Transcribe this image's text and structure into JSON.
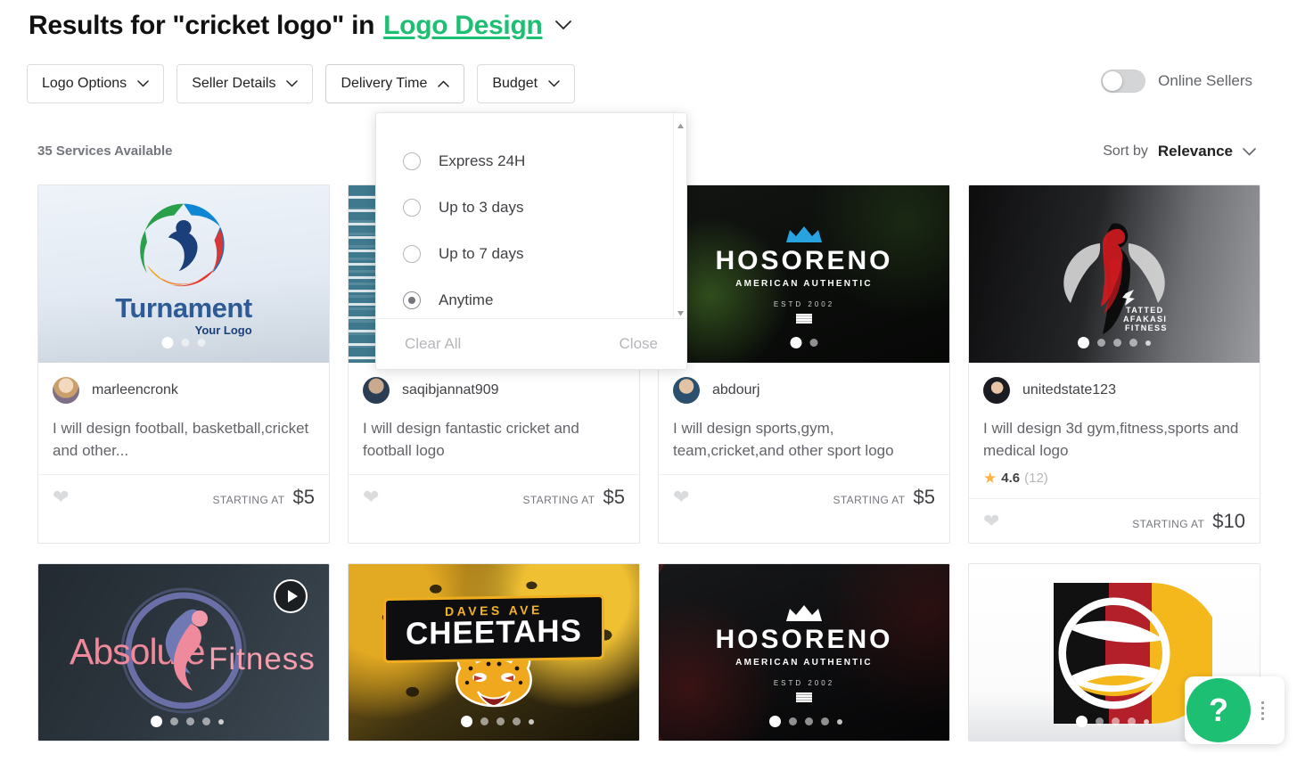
{
  "header": {
    "title_prefix": "Results for \"cricket logo\" in",
    "category": "Logo Design",
    "category_caret": "chevron-down"
  },
  "filters": [
    {
      "label": "Logo Options",
      "state": "collapsed",
      "caret": "chevron-down"
    },
    {
      "label": "Seller Details",
      "state": "collapsed",
      "caret": "chevron-down"
    },
    {
      "label": "Delivery Time",
      "state": "expanded",
      "caret": "chevron-up"
    },
    {
      "label": "Budget",
      "state": "collapsed",
      "caret": "chevron-down"
    }
  ],
  "online_sellers": {
    "label": "Online Sellers",
    "enabled": false
  },
  "results": {
    "count_label": "35 Services Available"
  },
  "sort": {
    "label": "Sort by",
    "value": "Relevance",
    "caret": "chevron-down"
  },
  "delivery_dropdown": {
    "options": [
      {
        "label": "Express 24H",
        "selected": false
      },
      {
        "label": "Up to 3 days",
        "selected": false
      },
      {
        "label": "Up to 7 days",
        "selected": false
      },
      {
        "label": "Anytime",
        "selected": true
      }
    ],
    "clear_label": "Clear All",
    "close_label": "Close",
    "scrollbar": true
  },
  "cards": [
    {
      "seller": "marleencronk",
      "description": "I will design football, basketball,cricket and other...",
      "price_prefix": "STARTING AT",
      "price": "$5",
      "rating": null,
      "reviews": null,
      "has_video": false,
      "dots": 3,
      "active_dot": 0,
      "art": "turnament",
      "art_text": {
        "name": "Turnament",
        "tagline": "Your Logo"
      }
    },
    {
      "seller": "saqibjannat909",
      "description": "I will design fantastic cricket and football logo",
      "price_prefix": "STARTING AT",
      "price": "$5",
      "rating": null,
      "reviews": null,
      "has_video": false,
      "dots": 0,
      "active_dot": 0,
      "art": "brickwall",
      "art_text": null
    },
    {
      "seller": "abdourj",
      "description": "I will design sports,gym, team,cricket,and other sport logo",
      "price_prefix": "STARTING AT",
      "price": "$5",
      "rating": null,
      "reviews": null,
      "has_video": false,
      "dots": 2,
      "active_dot": 0,
      "art": "hosoreno-green",
      "art_text": {
        "name": "HOSORENO",
        "tagline": "AMERICAN AUTHENTIC",
        "estd": "ESTD 2002"
      }
    },
    {
      "seller": "unitedstate123",
      "description": "I will design 3d gym,fitness,sports and medical logo",
      "price_prefix": "STARTING AT",
      "price": "$10",
      "rating": "4.6",
      "reviews": "(12)",
      "has_video": false,
      "dots": 5,
      "active_dot": 0,
      "art": "tatted",
      "art_text": {
        "line1": "TATTED",
        "line2": "AFAKASI",
        "line3": "FITNESS"
      }
    },
    {
      "seller": "",
      "description": "",
      "price_prefix": "",
      "price": "",
      "rating": null,
      "reviews": null,
      "has_video": true,
      "dots": 5,
      "active_dot": 0,
      "art": "absolute-fitness",
      "art_text": {
        "name1": "Absolute",
        "name2": "Fitness"
      }
    },
    {
      "seller": "",
      "description": "",
      "price_prefix": "",
      "price": "",
      "rating": null,
      "reviews": null,
      "has_video": false,
      "dots": 5,
      "active_dot": 0,
      "art": "cheetahs",
      "art_text": {
        "top": "DAVES AVE",
        "main": "CHEETAHS"
      }
    },
    {
      "seller": "",
      "description": "",
      "price_prefix": "",
      "price": "",
      "rating": null,
      "reviews": null,
      "has_video": false,
      "dots": 5,
      "active_dot": 0,
      "art": "hosoreno-red",
      "art_text": {
        "name": "HOSORENO",
        "tagline": "AMERICAN AUTHENTIC",
        "estd": "ESTD 2002"
      }
    },
    {
      "seller": "",
      "description": "",
      "price_prefix": "",
      "price": "",
      "rating": null,
      "reviews": null,
      "has_video": false,
      "dots": 5,
      "active_dot": 0,
      "art": "german-ball",
      "art_text": null
    }
  ],
  "help_widget": {
    "glyph": "?",
    "menu": "kebab-menu"
  },
  "colors": {
    "accent_green": "#1dbf73",
    "text_dark": "#404145",
    "text_muted": "#74767e",
    "border": "#e4e5e7",
    "star_yellow": "#ffb33e"
  }
}
